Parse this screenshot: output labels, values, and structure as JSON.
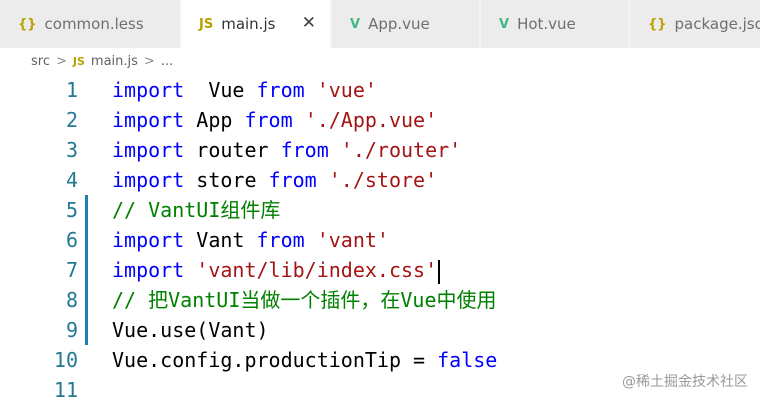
{
  "tabs": [
    {
      "icon": "{}",
      "label": "common.less",
      "icon_color": "#b8a200"
    },
    {
      "icon": "JS",
      "label": "main.js",
      "icon_color": "#b8a200",
      "active": true
    },
    {
      "icon": "V",
      "label": "App.vue",
      "icon_color": "#41b883"
    },
    {
      "icon": "V",
      "label": "Hot.vue",
      "icon_color": "#41b883"
    },
    {
      "icon": "{}",
      "label": "package.json",
      "icon_color": "#b8a200"
    }
  ],
  "close_glyph": "✕",
  "breadcrumb": {
    "folder": "src",
    "sep1": ">",
    "file_icon": "JS",
    "file": "main.js",
    "sep2": ">",
    "more": "..."
  },
  "lines": [
    {
      "n": "1",
      "parts": [
        [
          "kw",
          "import"
        ],
        [
          "",
          "  Vue "
        ],
        [
          "kw",
          "from"
        ],
        [
          "",
          " "
        ],
        [
          "str",
          "'vue'"
        ]
      ]
    },
    {
      "n": "2",
      "parts": [
        [
          "kw",
          "import"
        ],
        [
          "",
          " App "
        ],
        [
          "kw",
          "from"
        ],
        [
          "",
          " "
        ],
        [
          "str",
          "'./App.vue'"
        ]
      ]
    },
    {
      "n": "3",
      "parts": [
        [
          "kw",
          "import"
        ],
        [
          "",
          " router "
        ],
        [
          "kw",
          "from"
        ],
        [
          "",
          " "
        ],
        [
          "str",
          "'./router'"
        ]
      ]
    },
    {
      "n": "4",
      "parts": [
        [
          "kw",
          "import"
        ],
        [
          "",
          " store "
        ],
        [
          "kw",
          "from"
        ],
        [
          "",
          " "
        ],
        [
          "str",
          "'./store'"
        ]
      ]
    },
    {
      "n": "5",
      "parts": [
        [
          "cm",
          "// VantUI组件库"
        ]
      ]
    },
    {
      "n": "6",
      "parts": [
        [
          "kw",
          "import"
        ],
        [
          "",
          " Vant "
        ],
        [
          "kw",
          "from"
        ],
        [
          "",
          " "
        ],
        [
          "str",
          "'vant'"
        ]
      ]
    },
    {
      "n": "7",
      "parts": [
        [
          "kw",
          "import"
        ],
        [
          "",
          " "
        ],
        [
          "str",
          "'vant/lib/index.css'"
        ]
      ]
    },
    {
      "n": "8",
      "parts": [
        [
          "cm",
          "// 把VantUI当做一个插件，在Vue中使用"
        ]
      ]
    },
    {
      "n": "9",
      "parts": [
        [
          "",
          "Vue.use(Vant)"
        ]
      ]
    },
    {
      "n": "10",
      "parts": [
        [
          "",
          "Vue.config.productionTip = "
        ],
        [
          "kw",
          "false"
        ]
      ]
    },
    {
      "n": "11",
      "parts": []
    }
  ],
  "watermark": "@稀土掘金技术社区",
  "colors": {
    "keyword": "#0000ff",
    "string": "#a31515",
    "comment": "#008000",
    "line_number": "#237893",
    "modified_gutter": "#1b80b2"
  }
}
